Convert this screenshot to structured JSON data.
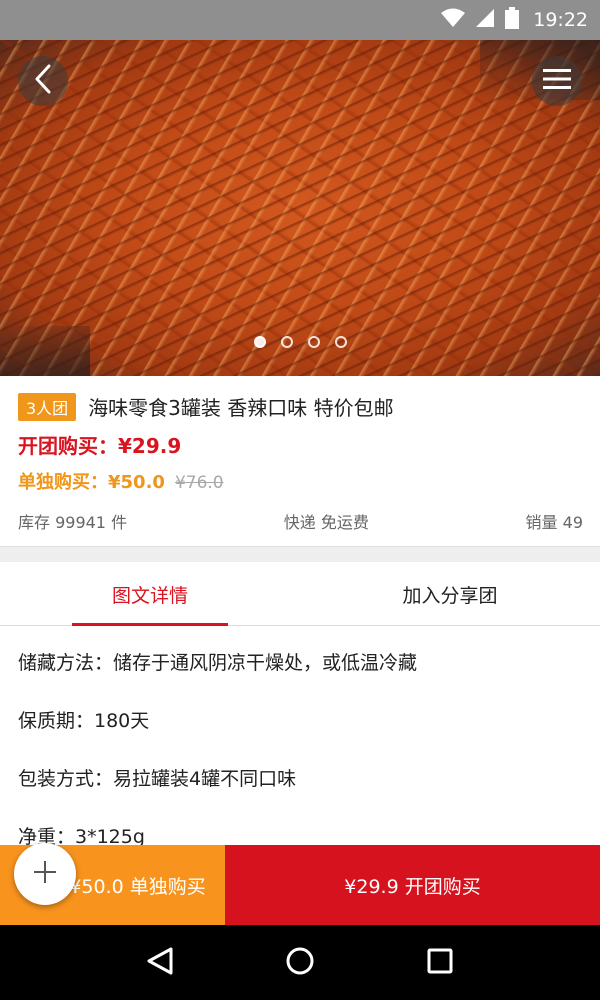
{
  "status_bar": {
    "time": "19:22",
    "icons": [
      "wifi-icon",
      "signal-icon",
      "battery-icon"
    ]
  },
  "hero": {
    "image_description_icon": "product-photo",
    "carousel": {
      "total": 4,
      "active_index": 0
    },
    "back_icon": "chevron-left-icon",
    "menu_icon": "hamburger-menu-icon"
  },
  "product": {
    "badge": "3人团",
    "title": "海味零食3罐装 香辣口味 特价包邮",
    "group_price_label": "开团购买：¥29.9",
    "single_price_label": "单独购买：¥50.0",
    "original_price": "¥76.0",
    "stock": "库存 99941 件",
    "shipping": "快递 免运费",
    "sales": "销量 49"
  },
  "tabs": [
    {
      "label": "图文详情",
      "active": true
    },
    {
      "label": "加入分享团",
      "active": false
    }
  ],
  "details": [
    "储藏方法：储存于通风阴凉干燥处，或低温冷藏",
    "保质期：180天",
    "包装方式：易拉罐装4罐不同口味",
    "净重：3*125g"
  ],
  "bottom_bar": {
    "single_button": "¥50.0 单独购买",
    "group_button": "¥29.9 开团购买"
  },
  "fab_icon": "plus-icon",
  "nav_bar": {
    "icons": [
      "back-triangle-icon",
      "home-circle-icon",
      "recents-square-icon"
    ]
  },
  "colors": {
    "accent_red": "#d9131f",
    "accent_orange": "#f0961a",
    "status_bar": "#8f8f8f"
  }
}
